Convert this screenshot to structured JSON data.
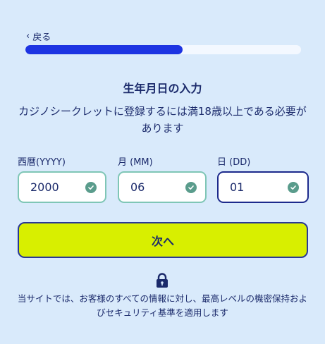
{
  "nav": {
    "back_label": "戻る"
  },
  "progress": {
    "fraction": 0.57
  },
  "heading": {
    "title": "生年月日の入力",
    "subtitle": "カジノシークレットに登録するには満18歳以上である必要があります"
  },
  "fields": [
    {
      "label": "西暦(YYYY)",
      "value": "2000"
    },
    {
      "label": "月 (MM)",
      "value": "06"
    },
    {
      "label": "日 (DD)",
      "value": "01"
    }
  ],
  "next_button": {
    "label": "次へ"
  },
  "security_notice": "当サイトでは、お客様のすべての情報に対し、最高レベルの機密保持およびセキュリティ基準を適用します",
  "colors": {
    "background": "#d9eafb",
    "progress": "#1d34e2",
    "button": "#d8ef00",
    "valid_border": "#7fc6b6",
    "active_border": "#1d2a8c"
  },
  "icons": {
    "back": "chevron-left-icon",
    "valid": "check-circle-icon",
    "lock": "lock-icon"
  }
}
